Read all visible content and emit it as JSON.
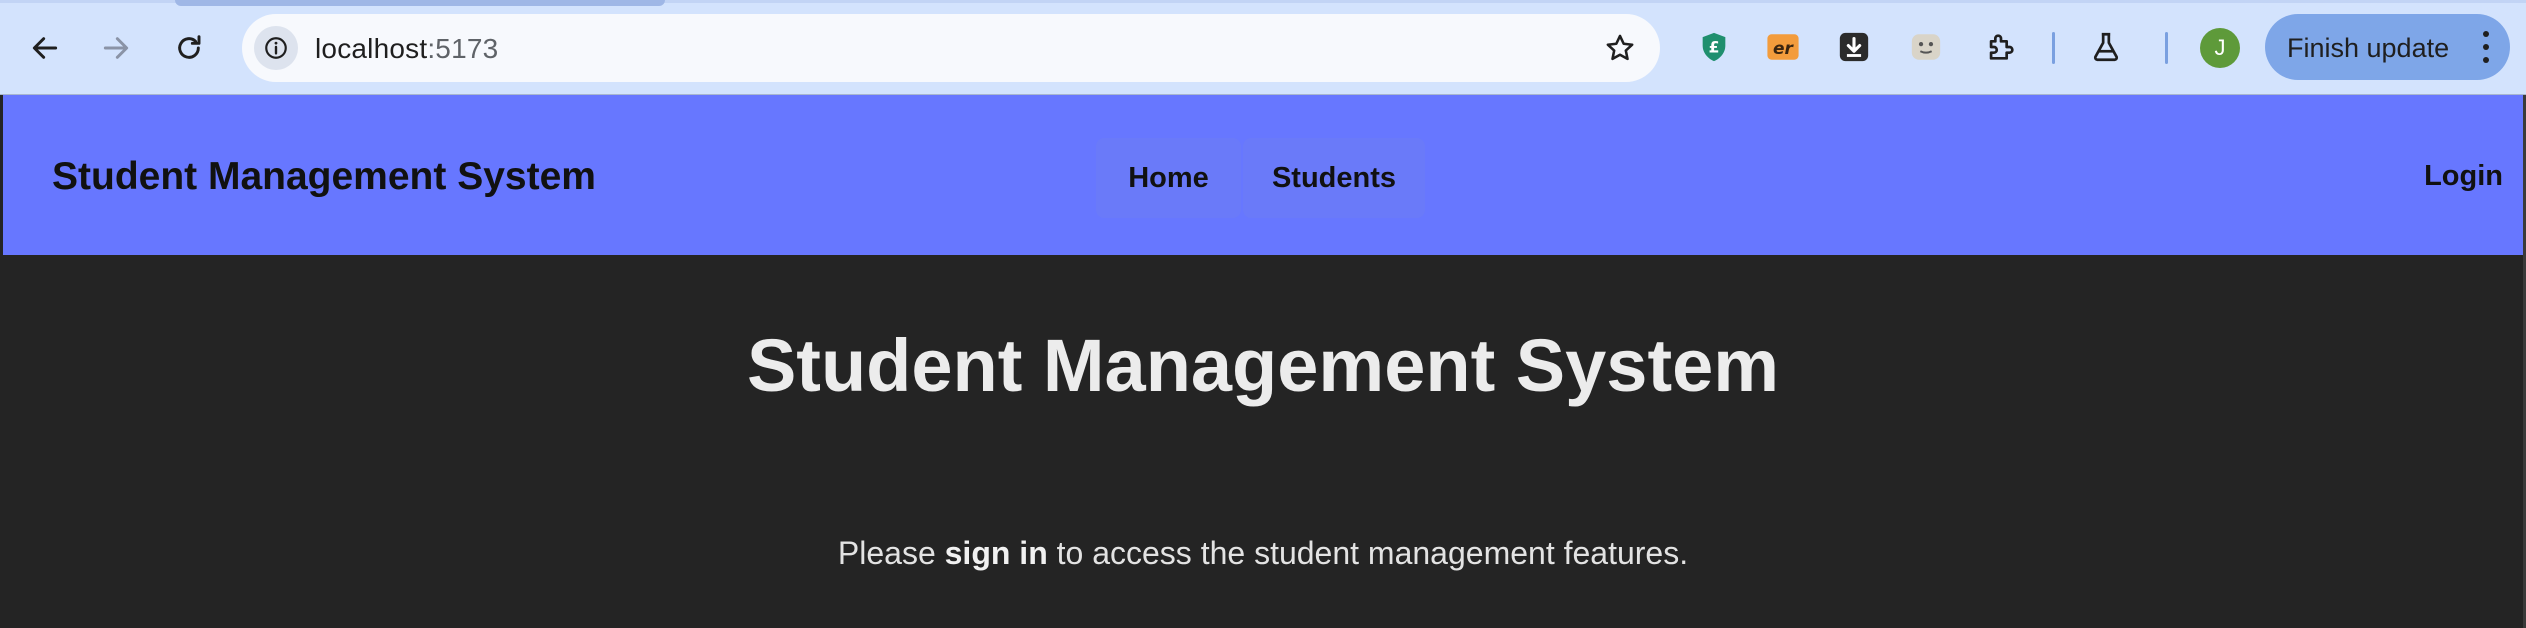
{
  "browser": {
    "url_host": "localhost",
    "url_port": ":5173",
    "profile_initial": "J",
    "update_label": "Finish update",
    "extension_icons": [
      "shield-extension-icon",
      "er-extension-icon",
      "download-extension-icon",
      "face-extension-icon",
      "puzzle-extensions-icon",
      "flask-labs-icon"
    ],
    "colors": {
      "chrome_bg": "#d3e3fd",
      "omnibox_bg": "#f7f9fd",
      "update_btn": "#7ea6e8",
      "avatar": "#5e9a3a"
    }
  },
  "navbar": {
    "brand": "Student Management System",
    "links": [
      {
        "label": "Home"
      },
      {
        "label": "Students"
      }
    ],
    "login": "Login",
    "bg": "#6777ff"
  },
  "main": {
    "title": "Student Management System",
    "message_prefix": "Please ",
    "message_link": "sign in",
    "message_suffix": " to access the student management features.",
    "bg": "#242424"
  }
}
